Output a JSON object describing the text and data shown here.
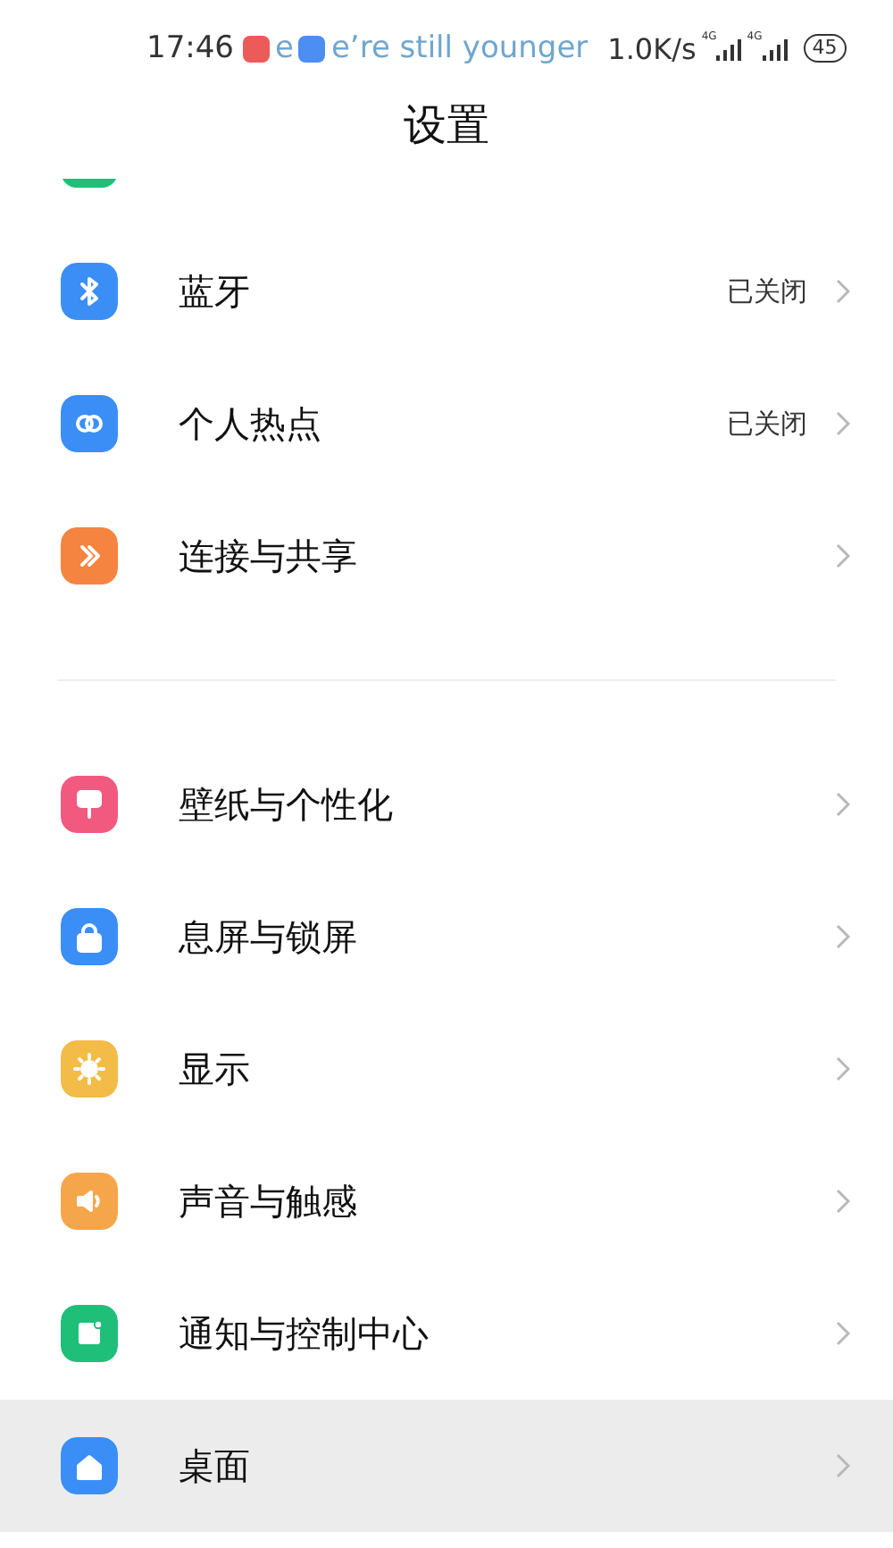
{
  "status_bar": {
    "time": "17:46",
    "ticker_fragment": "e",
    "ticker": "e’re still younger",
    "speed": "1.0K/s",
    "network_labels": [
      "4G",
      "4G"
    ],
    "battery": "45"
  },
  "title": "设置",
  "partial_row": {
    "color": "#1fbf7a"
  },
  "sections": [
    {
      "items": [
        {
          "label": "蓝牙",
          "value": "已关闭",
          "color": "#3a8ef6",
          "selected": false
        },
        {
          "label": "个人热点",
          "value": "已关闭",
          "color": "#3a8ef6",
          "selected": false
        },
        {
          "label": "连接与共享",
          "color": "#f4843f",
          "selected": false
        }
      ]
    },
    {
      "items": [
        {
          "label": "壁纸与个性化",
          "color": "#f2597f",
          "selected": false
        },
        {
          "label": "息屏与锁屏",
          "color": "#3a8ef6",
          "selected": false
        },
        {
          "label": "显示",
          "color": "#f3bb47",
          "selected": false
        },
        {
          "label": "声音与触感",
          "color": "#f5a64a",
          "selected": false
        },
        {
          "label": "通知与控制中心",
          "color": "#1fbf7a",
          "selected": false
        },
        {
          "label": "桌面",
          "color": "#3a8ef6",
          "selected": true
        }
      ]
    }
  ]
}
